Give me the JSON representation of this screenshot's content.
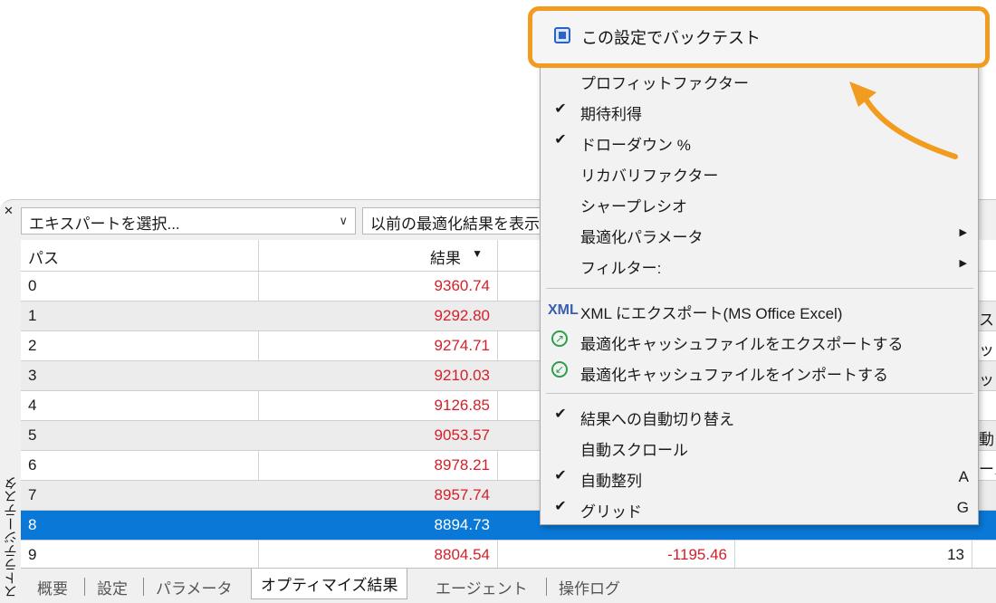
{
  "toolbar": {
    "expert_select": "エキスパートを選択...",
    "prev_results": "以前の最適化結果を表示"
  },
  "side_title": "ストラテジーテスター",
  "table": {
    "headers": {
      "pass": "パス",
      "result": "結果"
    },
    "rows": [
      {
        "pass": "0",
        "result": "9360.74"
      },
      {
        "pass": "1",
        "result": "9292.80"
      },
      {
        "pass": "2",
        "result": "9274.71"
      },
      {
        "pass": "3",
        "result": "9210.03"
      },
      {
        "pass": "4",
        "result": "9126.85"
      },
      {
        "pass": "5",
        "result": "9053.57"
      },
      {
        "pass": "6",
        "result": "8978.21"
      },
      {
        "pass": "7",
        "result": "8957.74"
      },
      {
        "pass": "8",
        "result": "8894.73",
        "selected": true
      },
      {
        "pass": "9",
        "result": "8804.54",
        "profit": "-1195.46",
        "trades": "13"
      }
    ],
    "right_edge": [
      "ス",
      "ッ",
      "ッ",
      "動",
      "ール"
    ]
  },
  "tabs": [
    "概要",
    "設定",
    "パラメータ",
    "オプティマイズ結果",
    "エージェント",
    "操作ログ"
  ],
  "menu": {
    "highlighted": "この設定でバックテスト",
    "items": [
      {
        "label": "プロフィットファクター",
        "check": "",
        "shortcut": ""
      },
      {
        "label": "期待利得",
        "check": "✔",
        "shortcut": ""
      },
      {
        "label": "ドローダウン %",
        "check": "✔",
        "shortcut": ""
      },
      {
        "label": "リカバリファクター",
        "check": "",
        "shortcut": ""
      },
      {
        "label": "シャープレシオ",
        "check": "",
        "shortcut": ""
      },
      {
        "label": "最適化パラメータ",
        "check": "",
        "submenu": "▶"
      },
      {
        "label": "フィルター:",
        "check": "",
        "submenu": "▶"
      },
      {
        "label": "XML にエクスポート(MS Office Excel)",
        "icon": "XML"
      },
      {
        "label": "最適化キャッシュファイルをエクスポートする",
        "icon": "↗"
      },
      {
        "label": "最適化キャッシュファイルをインポートする",
        "icon": "↙"
      },
      {
        "label": "結果への自動切り替え",
        "check": "✔"
      },
      {
        "label": "自動スクロール",
        "check": ""
      },
      {
        "label": "自動整列",
        "check": "✔",
        "shortcut": "A"
      },
      {
        "label": "グリッド",
        "check": "✔",
        "shortcut": "G"
      }
    ]
  },
  "colors": {
    "accent": "#f29c1f",
    "selected_row": "#0a78d7",
    "negative": "#d4202a"
  }
}
